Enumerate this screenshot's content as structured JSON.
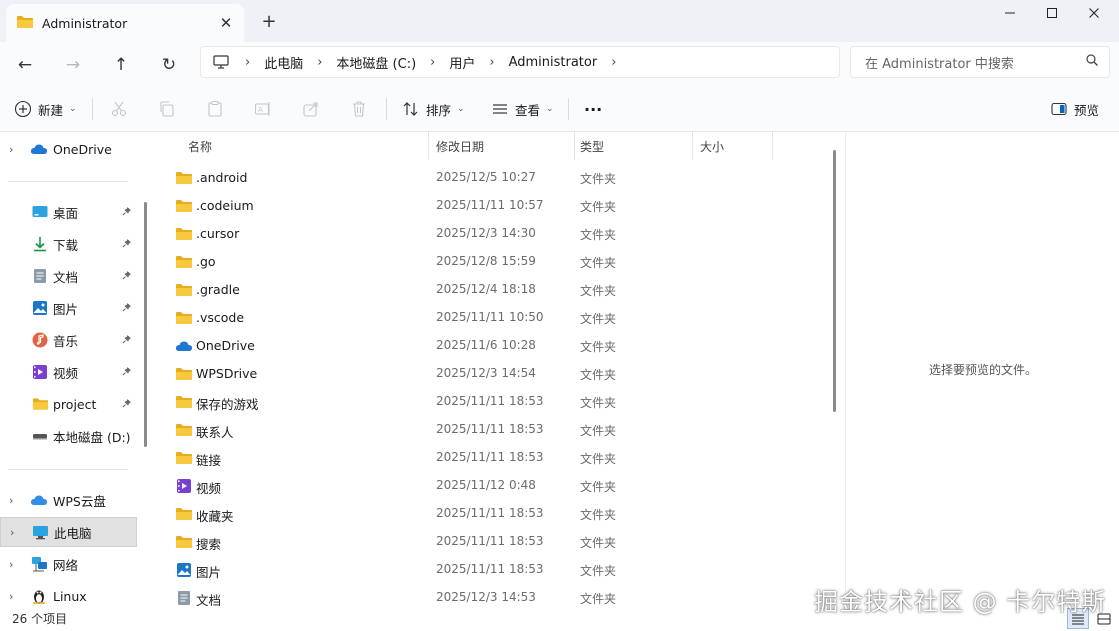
{
  "window": {
    "tab_title": "Administrator",
    "tab_close_glyph": "✕",
    "new_tab_glyph": "+",
    "minimize_glyph": "—",
    "close_glyph": "✕"
  },
  "nav": {
    "back_glyph": "←",
    "forward_glyph": "→",
    "up_glyph": "↑",
    "refresh_glyph": "↻"
  },
  "address": {
    "crumbs": [
      "此电脑",
      "本地磁盘 (C:)",
      "用户",
      "Administrator"
    ],
    "separator": "›"
  },
  "search": {
    "placeholder": "在 Administrator 中搜索"
  },
  "toolbar": {
    "new_label": "新建",
    "sort_label": "排序",
    "view_label": "查看",
    "more_label": "···",
    "preview_label": "预览",
    "caret": "⌄"
  },
  "sidebar": {
    "chevron": "›",
    "pin": "📌",
    "onedrive": "OneDrive",
    "items": [
      {
        "label": "桌面",
        "icon": "desktop-icon"
      },
      {
        "label": "下载",
        "icon": "download-icon"
      },
      {
        "label": "文档",
        "icon": "document-icon"
      },
      {
        "label": "图片",
        "icon": "picture-icon"
      },
      {
        "label": "音乐",
        "icon": "music-icon"
      },
      {
        "label": "视频",
        "icon": "video-icon"
      },
      {
        "label": "project",
        "icon": "folder-icon"
      },
      {
        "label": "本地磁盘 (D:)",
        "icon": "drive-icon"
      }
    ],
    "bottom": [
      {
        "label": "WPS云盘",
        "icon": "cloud-icon"
      },
      {
        "label": "此电脑",
        "icon": "computer-icon"
      },
      {
        "label": "网络",
        "icon": "network-icon"
      },
      {
        "label": "Linux",
        "icon": "linux-icon"
      }
    ]
  },
  "columns": {
    "name": "名称",
    "date": "修改日期",
    "type": "类型",
    "size": "大小",
    "sort_glyph": "⌃"
  },
  "files": [
    {
      "name": ".android",
      "date": "2025/12/5 10:27",
      "type": "文件夹",
      "icon": "folder"
    },
    {
      "name": ".codeium",
      "date": "2025/11/11 10:57",
      "type": "文件夹",
      "icon": "folder"
    },
    {
      "name": ".cursor",
      "date": "2025/12/3 14:30",
      "type": "文件夹",
      "icon": "folder"
    },
    {
      "name": ".go",
      "date": "2025/12/8 15:59",
      "type": "文件夹",
      "icon": "folder"
    },
    {
      "name": ".gradle",
      "date": "2025/12/4 18:18",
      "type": "文件夹",
      "icon": "folder"
    },
    {
      "name": ".vscode",
      "date": "2025/11/11 10:50",
      "type": "文件夹",
      "icon": "folder"
    },
    {
      "name": "OneDrive",
      "date": "2025/11/6 10:28",
      "type": "文件夹",
      "icon": "onedrive"
    },
    {
      "name": "WPSDrive",
      "date": "2025/12/3 14:54",
      "type": "文件夹",
      "icon": "folder"
    },
    {
      "name": "保存的游戏",
      "date": "2025/11/11 18:53",
      "type": "文件夹",
      "icon": "folder"
    },
    {
      "name": "联系人",
      "date": "2025/11/11 18:53",
      "type": "文件夹",
      "icon": "folder"
    },
    {
      "name": "链接",
      "date": "2025/11/11 18:53",
      "type": "文件夹",
      "icon": "folder"
    },
    {
      "name": "视频",
      "date": "2025/11/12 0:48",
      "type": "文件夹",
      "icon": "video"
    },
    {
      "name": "收藏夹",
      "date": "2025/11/11 18:53",
      "type": "文件夹",
      "icon": "folder"
    },
    {
      "name": "搜索",
      "date": "2025/11/11 18:53",
      "type": "文件夹",
      "icon": "folder"
    },
    {
      "name": "图片",
      "date": "2025/11/11 18:53",
      "type": "文件夹",
      "icon": "picture"
    },
    {
      "name": "文档",
      "date": "2025/12/3 14:53",
      "type": "文件夹",
      "icon": "document"
    }
  ],
  "preview": {
    "message": "选择要预览的文件。"
  },
  "status": {
    "count": "26 个项目"
  },
  "watermark": "掘金技术社区 @ 卡尔特斯",
  "colors": {
    "folder": "#f8c93e",
    "folder_dark": "#e9ac1f",
    "accent": "#0067c0",
    "onedrive": "#1e78d4"
  }
}
